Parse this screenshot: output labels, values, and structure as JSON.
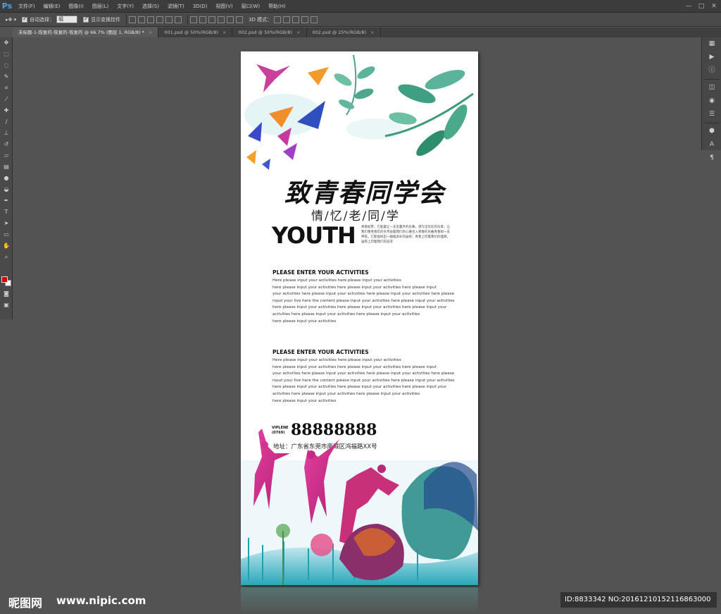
{
  "app": {
    "logo": "Ps"
  },
  "menu": [
    "文件(F)",
    "编辑(E)",
    "图像(I)",
    "图层(L)",
    "文字(Y)",
    "选择(S)",
    "滤镜(T)",
    "3D(D)",
    "视图(V)",
    "窗口(W)",
    "帮助(H)"
  ],
  "window_controls": [
    "—",
    "□",
    "✕"
  ],
  "options": {
    "auto_select_label": "自动选择：",
    "auto_select_value": "组",
    "show_transform_label": "显示变换控件",
    "mode_3d_label": "3D 模式："
  },
  "tabs": [
    {
      "label": "未标题-1-恢复的-恢复的-恢复的 @ 66.7% (图层 1, RGB/8) *",
      "close": "×"
    },
    {
      "label": "001.psd @ 50%(RGB/8)",
      "close": "×"
    },
    {
      "label": "002.psd @ 50%(RGB/8)",
      "close": "×"
    },
    {
      "label": "002.psd @ 25%(RGB/8)",
      "close": "×"
    }
  ],
  "colors": {
    "foreground": "#d40000",
    "background": "#ffffff"
  },
  "poster": {
    "title": "致青春同学会",
    "subtitle": "情/忆/老/同/学",
    "youth": "YOUTH",
    "youth_body": "青春如梦，它能最让一支支赢弄的乐舞，谱写出华彩的乐章；让我们重青春年的岁月站着我们的心难合入青春的乐曲青春如一支神笔，它能描绘出一幅幅多彩的画卷；青春上印着我们的理想，画卷上印着我们的追求",
    "section1": {
      "heading": "PLEASE ENTER YOUR ACTIVITIES",
      "lines": [
        "Here please input your activities here please input your activities",
        "here please input your activities here please input your activities here please input",
        "your activities here please input your activities here please input your activities here please",
        "input your live here the content please input your activities here please input your activities",
        "here please input your activities here please input your activities here please input your",
        "activities here please input your activities here please input your activities",
        "here please input your activities"
      ]
    },
    "section2": {
      "heading": "PLEASE ENTER YOUR ACTIVITIES",
      "lines": [
        "Here please input your activities here please input your activities",
        "here please input your activities here please input your activities here please input",
        "your activities here please input your activities here please input your activities here please",
        "input your live here the content please input your activities here please input your activities",
        "here please input your activities here please input your activities here please input your",
        "activities here please input your activities here please input your activities",
        "here please input your activities"
      ]
    },
    "vipline": "VIPLENE",
    "area_code": "(0769)",
    "phone": "88888888",
    "address": "地址：广东省东莞市南城区鸿福路XX号"
  },
  "watermark": {
    "logo": "昵图网",
    "url": "www.nipic.com",
    "id": "ID:8833342 NO:20161210152116863000"
  }
}
